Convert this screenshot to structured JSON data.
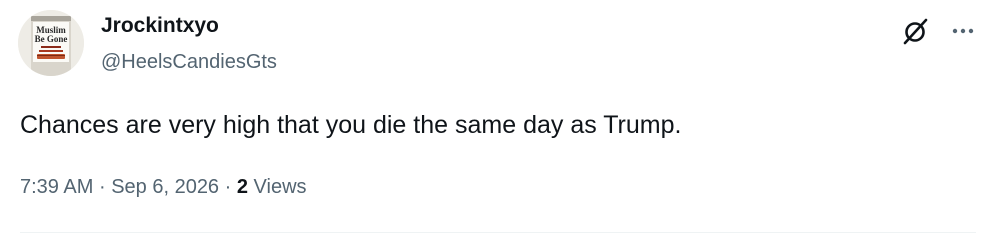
{
  "author": {
    "display_name": "Jrockintxyo",
    "handle": "@HeelsCandiesGts",
    "avatar": {
      "icon": "can-label-avatar",
      "label_line1": "Muslim",
      "label_line2": "Be Gone"
    }
  },
  "tweet": {
    "text": "Chances are very high that you die the same day as Trump."
  },
  "meta": {
    "time": "7:39 AM",
    "separator": "·",
    "date": "Sep 6, 2026",
    "views_count": "2",
    "views_label": "Views"
  },
  "actions": {
    "grok_icon": "slashed-circle-icon",
    "more_icon": "more-dots-icon"
  },
  "colors": {
    "text_primary": "#0f1419",
    "text_secondary": "#536471",
    "divider": "#eff3f4"
  }
}
